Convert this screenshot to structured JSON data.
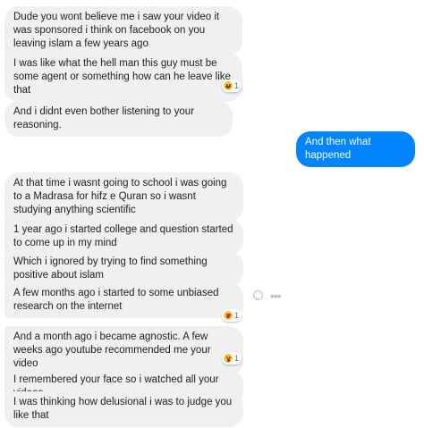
{
  "messages": [
    {
      "id": "m1",
      "text": "Dude you wont believe me i saw your video it was sponsored i think on facebook on you leaving islam a few years ago"
    },
    {
      "id": "m2",
      "text": "I was like what the hell man this guy must be some agent or something how can he leave like that"
    },
    {
      "id": "m3",
      "text": "And i didnt even bother listening to your reasoning."
    },
    {
      "id": "m4",
      "text": "And then what happened"
    },
    {
      "id": "m5",
      "text": "At that time i wasnt going to school i was going to a Madrasa for hifz e Quran so i wasnt studying anything scientific"
    },
    {
      "id": "m6",
      "text": "1 year ago i started college and question started to come up in my mind"
    },
    {
      "id": "m7",
      "text": "Which i ignored by trying to find something positive about islam"
    },
    {
      "id": "m8",
      "text": "A few months ago i started to some unbiased research on the internet"
    },
    {
      "id": "m9",
      "text": "And a month ago i became agnostic. A few weeks ago youtube recommended me your video"
    },
    {
      "id": "m10",
      "text": "I remembered your face so i watched all your videos"
    },
    {
      "id": "m11",
      "text": "I was thinking how delusional i was to judge you like that"
    }
  ],
  "reactions": {
    "r1": {
      "icon": "laughing-emoji-icon",
      "count": "1"
    },
    "r2": {
      "icon": "heart-eyes-emoji-icon",
      "count": "1"
    },
    "r3": {
      "icon": "surprised-emoji-icon",
      "count": "1"
    }
  },
  "hover_tools": {
    "react_icon": "smiley-icon",
    "more_icon": "more-options-icon"
  },
  "colors": {
    "incoming_bubble": "#f0f0f0",
    "outgoing_bubble": "#0084ff",
    "text": "#1c1e21"
  }
}
